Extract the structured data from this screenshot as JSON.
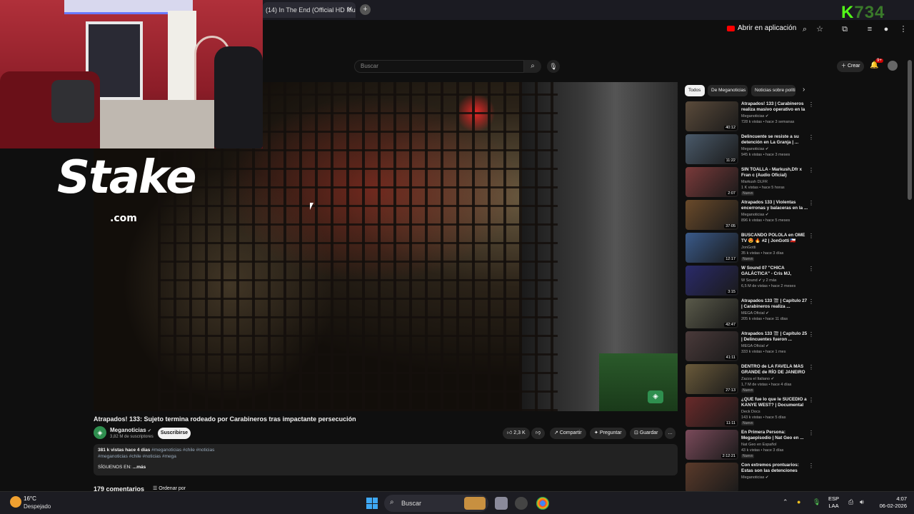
{
  "browser": {
    "tab_title": "(14) In The End (Official HD Mu",
    "tab_close": "✕",
    "new_tab": "+",
    "stream_logo_main": "K",
    "stream_logo_rest": "734",
    "open_in_app": "Abrir en aplicación"
  },
  "header": {
    "search_placeholder": "Buscar",
    "create_label": "Crear",
    "notif_count": "9+"
  },
  "overlay": {
    "stake_word": "Stake",
    "stake_domain": ".com"
  },
  "video": {
    "title": "Atrapados! 133: Sujeto termina rodeado por Carabineros tras impactante persecución",
    "channel": "Meganoticias",
    "channel_verified": "✔",
    "subscribers": "3,82 M de suscriptores",
    "subscribe": "Suscribirse",
    "likes": "2,3 K",
    "share": "Compartir",
    "ask": "Preguntar",
    "save": "Guardar",
    "more": "…",
    "desc_views": "381 k vistas  hace 4 días",
    "desc_tags1": "#meganoticias #chile #noticias",
    "desc_tags2": "#meganoticias #chile #noticias #mega",
    "desc_follow": "SÍGUENOS EN:",
    "desc_more": "...más",
    "comments_count": "179 comentarios",
    "sort_by": "Ordenar por"
  },
  "sidebar": {
    "chips": [
      "Todos",
      "De Meganoticias",
      "Noticias sobre polític"
    ],
    "items": [
      {
        "title": "Atrapados! 133 | Carabineros realiza masivo operativo en la ...",
        "channel": "Meganoticias ✔",
        "meta": "728 k vistas • hace 3 semanas",
        "duration": "40:12",
        "new": "",
        "color": "#5a4a3a"
      },
      {
        "title": "Delincuente se resiste a su detención en La Granja | ...",
        "channel": "Meganoticias ✔",
        "meta": "945 k vistas • hace 3 meses",
        "duration": "11:22",
        "new": "",
        "color": "#4a5a6a"
      },
      {
        "title": "SIN TOALLA - Markush,Dfr x Fran c (Audio Oficial)",
        "channel": "Markush DLFR",
        "meta": "1 K vistas • hace 5 horas",
        "duration": "2:07",
        "new": "Nuevo",
        "color": "#7a3a3a"
      },
      {
        "title": "Atrapados 133 | Violentas encerronas y balaceras en la ...",
        "channel": "Meganoticias ✔",
        "meta": "896 k vistas • hace 5 meses",
        "duration": "37:05",
        "new": "",
        "color": "#6a4a2a"
      },
      {
        "title": "BUSCANDO POLOLA en OME TV 😍 🔥 #2 | JonGotti 🇨🇱",
        "channel": "JonGotti",
        "meta": "35 k vistas • hace 3 días",
        "duration": "12:17",
        "new": "Nuevo",
        "color": "#3a5a8a"
      },
      {
        "title": "W Sound 07 \"CHICA GALÁCTICA\" - Cris MJ, Westc...",
        "channel": "W Sound ✔ y 2 más",
        "meta": "6,5 M de vistas • hace 2 meses",
        "duration": "3:15",
        "new": "",
        "color": "#2a2a6a"
      },
      {
        "title": "Atrapados 133 🎬 | Capítulo 27 | Carabineros realiza ...",
        "channel": "MEGA Oficial ✔",
        "meta": "205 k vistas • hace 11 días",
        "duration": "42:47",
        "new": "",
        "color": "#5a5a4a"
      },
      {
        "title": "Atrapados 133 🎬 | Capítulo 25 | Delincuentes fueron ...",
        "channel": "MEGA Oficial ✔",
        "meta": "333 k vistas • hace 1 mes",
        "duration": "41:11",
        "new": "",
        "color": "#4a3a3a"
      },
      {
        "title": "DENTRO de LA FAVELA MÁS GRANDE de RÍO DE JANEIRO ...",
        "channel": "Zazza el Italiano ✔",
        "meta": "1,7 M de vistas • hace 4 días",
        "duration": "27:13",
        "new": "Nuevo",
        "color": "#6a5a3a"
      },
      {
        "title": "¿QUÉ fue lo que le SUCEDIÓ a KANYE WEST? | Documental",
        "channel": "Deck Docs",
        "meta": "143 k vistas • hace 5 días",
        "duration": "11:11",
        "new": "Nuevo",
        "color": "#6a2a2a"
      },
      {
        "title": "En Primera Persona: Megaepisodio | Nat Geo en ...",
        "channel": "Nat Geo en Español",
        "meta": "43 k vistas • hace 3 días",
        "duration": "2:12:21",
        "new": "Nuevo",
        "color": "#7a4a5a"
      },
      {
        "title": "Con extremos prontuarios: Estas son las detenciones má...",
        "channel": "Meganoticias ✔",
        "meta": "",
        "duration": "",
        "new": "",
        "color": "#5a3a2a"
      }
    ]
  },
  "taskbar": {
    "temp": "16°C",
    "weather": "Despejado",
    "search": "Buscar",
    "lang1": "ESP",
    "lang2": "LAA",
    "time": "4:07",
    "date": "06-02-2026"
  }
}
